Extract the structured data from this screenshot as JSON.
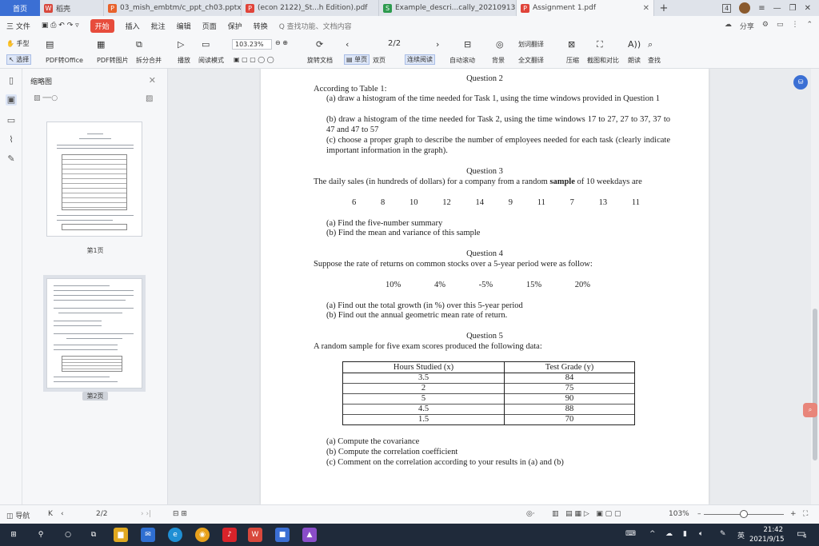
{
  "tabs": {
    "home": "首页",
    "items": [
      {
        "label": "稻壳",
        "icon": "wps-icon"
      },
      {
        "label": "03_mish_embtm/c_ppt_ch03.pptx",
        "icon": "ppt-icon"
      },
      {
        "label": "(econ 2122)_St...h Edition).pdf",
        "icon": "pdf-icon"
      },
      {
        "label": "Example_descri...cally_20210913",
        "icon": "xls-icon"
      },
      {
        "label": "Assignment 1.pdf",
        "icon": "pdf-icon",
        "active": true
      }
    ],
    "badge": "4"
  },
  "menu": {
    "file": "三 文件",
    "items": [
      "开始",
      "插入",
      "批注",
      "编辑",
      "页面",
      "保护",
      "转换"
    ],
    "active": "开始",
    "search": "Q 查找功能、文档内容",
    "share": "分享"
  },
  "toolbar": {
    "hand": "手型",
    "select": "选择",
    "pdf_to_office": "PDF转Office",
    "pdf_to_image": "PDF转图片",
    "split_merge": "拆分合并",
    "play": "播放",
    "read_mode": "阅读模式",
    "zoom": "103.23%",
    "page": "2/2",
    "rotate": "旋转文档",
    "single": "单页",
    "double": "双页",
    "continuous": "连续阅读",
    "auto_scroll": "自动滚动",
    "background": "背景",
    "translate_word": "划词翻译",
    "translate_full": "全文翻译",
    "compress": "压缩",
    "screenshot": "截图和对比",
    "read_aloud": "朗读",
    "find": "查找"
  },
  "sidebar": {
    "title": "缩略图",
    "page1_label": "第1页",
    "page2_label": "第2页"
  },
  "document": {
    "q2": {
      "title": "Question 2",
      "intro": "According to Table 1:",
      "a": "(a) draw a histogram of the time needed for Task 1, using the time windows provided in Question 1",
      "b": "(b) draw a histogram of the time needed for Task 2, using the time windows 17 to 27, 27 to 37, 37 to 47 and 47 to 57",
      "c": "(c) choose a proper graph to describe the number of employees needed for each task (clearly indicate important information in the graph)."
    },
    "q3": {
      "title": "Question 3",
      "intro_a": "The daily sales (in hundreds of dollars) for a company from a random ",
      "intro_bold": "sample",
      "intro_b": " of 10 weekdays are",
      "values": [
        "6",
        "8",
        "10",
        "12",
        "14",
        "9",
        "11",
        "7",
        "13",
        "11"
      ],
      "a": "(a) Find the five-number summary",
      "b": "(b) Find the mean and variance of this sample"
    },
    "q4": {
      "title": "Question 4",
      "intro": "Suppose the rate of returns on common stocks over a 5-year period were as follow:",
      "rates": [
        "10%",
        "4%",
        "-5%",
        "15%",
        "20%"
      ],
      "a": "(a) Find out the total growth (in %) over this 5-year period",
      "b": "(b) Find out the annual geometric mean rate of return."
    },
    "q5": {
      "title": "Question 5",
      "intro": "A random sample for five exam scores produced the following data:",
      "headers": [
        "Hours Studied (x)",
        "Test Grade (y)"
      ],
      "rows": [
        [
          "3.5",
          "84"
        ],
        [
          "2",
          "75"
        ],
        [
          "5",
          "90"
        ],
        [
          "4.5",
          "88"
        ],
        [
          "1.5",
          "70"
        ]
      ],
      "a": "(a) Compute the covariance",
      "b": "(b) Compute the correlation coefficient",
      "c": "(c) Comment on the correlation according to your results in (a) and (b)"
    }
  },
  "statusbar": {
    "nav": "导航",
    "page": "2/2",
    "zoom": "103%"
  },
  "taskbar": {
    "time": "21:42",
    "date": "2021/9/15",
    "ime": "英",
    "notify": "4"
  }
}
